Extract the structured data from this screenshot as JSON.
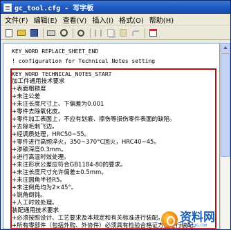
{
  "window": {
    "title": "gc_tool.cfg - 写字板"
  },
  "menu": {
    "items": [
      "文件(F)",
      "编辑(E)",
      "查看(V)",
      "插入(I)",
      "格式(O)",
      "帮助(H)"
    ]
  },
  "toolbar": {
    "icons": [
      "new-icon",
      "open-icon",
      "save-icon",
      "print-icon",
      "print-preview-icon",
      "find-icon",
      "cut-icon",
      "copy-icon",
      "paste-icon",
      "undo-icon",
      "date-time-icon"
    ]
  },
  "document": {
    "pre_lines": [
      "KEY_WORD REPLACE_SHEET_END",
      "! configuration for Technical Notes setting"
    ],
    "block_lines": [
      "KEY_WORD TECHNICAL_NOTES_START",
      "加工件通用技术要求",
      "+表面粗糙度",
      "+未注公差",
      "+未注长度尺寸上、下偏差为0.001",
      "+零件去除氧化皮。",
      "+零件加工表面上，不应有划痕、擦伤等损伤零件表面的缺陷。",
      "+去除毛刺飞边。",
      "+经调质处理，HRC50~55。",
      "+零件进行高频淬火，350~370°C回火，HRC40~45。",
      "+渗碳深度0.3mm。",
      "+进行高温时效处理。",
      "+未注形状公差应符合GB1184-80的要求。",
      "+未注长度尺寸允许偏差±0.5mm。",
      "+未注圆角半径R5。",
      "+未注倒角均为2×45°。",
      "+锐角倒钝。",
      "+人工时效处理。",
      "装配通用技术要求",
      "+必须按照设计、工艺要求及本规定和有关标准进行装配。",
      "+所有零部件（包括外购、外协件）必须具有检验合格证方能进行装配。"
    ]
  },
  "watermark": {
    "text": "资料网",
    "sub": "ZL.NETBIG.COM"
  }
}
